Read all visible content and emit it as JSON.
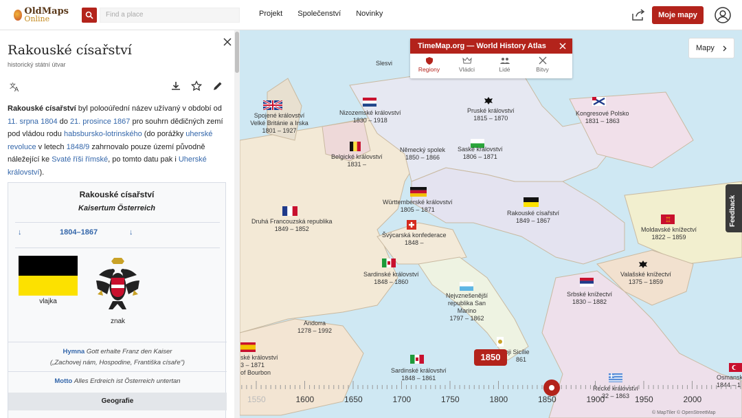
{
  "header": {
    "logo_line1": "OldMaps",
    "logo_line2": "Online",
    "search_placeholder": "Find a place",
    "nav": [
      "Projekt",
      "Společenství",
      "Novinky"
    ],
    "my_maps": "Moje mapy"
  },
  "panel": {
    "title": "Rakouské císařství",
    "subtitle": "historický státní útvar",
    "intro": {
      "bold": "Rakouské císařství",
      "t1": " byl polooúřední název užívaný v období od ",
      "l1": "11. srpna 1804",
      "t2": " do ",
      "l2": "21. prosince 1867",
      "t3": " pro souhrn dědičných zemí pod vládou rodu ",
      "l3": "habsbursko-lotrinského",
      "t4": " (do porážky ",
      "l4": "uherské revoluce",
      "t5": " v letech ",
      "l5": "1848/9",
      "t6": " zahrnovalo pouze území původně náležející ke ",
      "l6": "Svaté říši římské",
      "t7": ", po tomto datu pak i ",
      "l7": "Uherské království",
      "t8": ")."
    },
    "infobox": {
      "title": "Rakouské císařství",
      "native": "Kaisertum Österreich",
      "prev_arrow": "↓",
      "dates": "1804–1867",
      "next_arrow": "↓",
      "flag_caption": "vlajka",
      "coa_caption": "znak",
      "anthem_label": "Hymna",
      "anthem_text": "Gott erhalte Franz den Kaiser",
      "anthem_translation": "(„Zachovej nám, Hospodine, Františka císaře“)",
      "motto_label": "Motto",
      "motto_text": "Alles Erdreich ist Österreich untertan",
      "section": "Geografie"
    }
  },
  "map": {
    "timemap_title": "TimeMap.org — World History Atlas",
    "tabs": [
      "Regiony",
      "Vládci",
      "Lidé",
      "Bitvy"
    ],
    "mapy_button": "Mapy",
    "feedback": "Feedback",
    "current_year": "1850",
    "year_ticks": [
      "1550",
      "1600",
      "1650",
      "1700",
      "1750",
      "1800",
      "1850",
      "1900",
      "1950",
      "2000"
    ],
    "timeline_value": 1855,
    "attribution": "© MapTiler © OpenStreetMap",
    "labels": [
      {
        "name": "Slesvi",
        "years": ""
      },
      {
        "name": "Spojené království Velké Británie a Irska",
        "years": "1801 – 1927"
      },
      {
        "name": "Nizozemské království",
        "years": "1830 – 1918"
      },
      {
        "name": "Pruské království",
        "years": "1815 – 1870"
      },
      {
        "name": "Kongresové Polsko",
        "years": "1831 – 1863"
      },
      {
        "name": "Belgické království",
        "years": "1831 –"
      },
      {
        "name": "Německý spolek",
        "years": "1850 – 1866"
      },
      {
        "name": "Saské království",
        "years": "1806 – 1871"
      },
      {
        "name": "Württemberské království",
        "years": "1805 – 1871"
      },
      {
        "name": "Druhá Francouzská republika",
        "years": "1849 – 1852"
      },
      {
        "name": "Rakouské císařství",
        "years": "1849 – 1867"
      },
      {
        "name": "Švýcarská konfederace",
        "years": "1848 –"
      },
      {
        "name": "Moldavské knížectví",
        "years": "1822 – 1859"
      },
      {
        "name": "Sardinské království",
        "years": "1848 – 1860"
      },
      {
        "name": "Valašské knížectví",
        "years": "1375 – 1859"
      },
      {
        "name": "Nejvznešenější republika San Marino",
        "years": "1797 – 1862"
      },
      {
        "name": "Srbské knížectví",
        "years": "1830 – 1882"
      },
      {
        "name": "Andorra",
        "years": "1278 – 1992"
      },
      {
        "name": "ské království",
        "years": "3 – 1871"
      },
      {
        "name": "of Bourbon",
        "years": ""
      },
      {
        "name": "oji Sicílie",
        "years": "861"
      },
      {
        "name": "Sardinské království",
        "years": "1848 – 1861"
      },
      {
        "name": "Řecké království",
        "years": "32 – 1863"
      },
      {
        "name": "Osmansk",
        "years": "1844 – 1"
      }
    ]
  }
}
